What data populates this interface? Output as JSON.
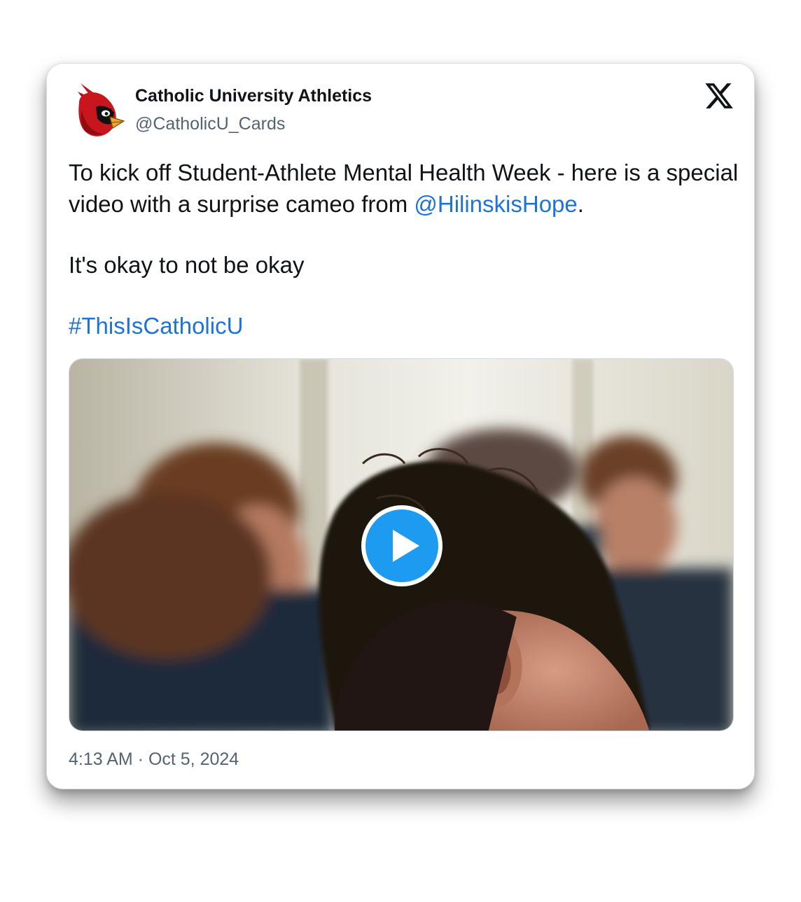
{
  "author": {
    "display_name": "Catholic University Athletics",
    "handle": "@CatholicU_Cards",
    "avatar_icon": "cardinal-mascot-icon"
  },
  "platform": {
    "logo_icon": "x-logo-icon"
  },
  "tweet": {
    "line1": "To kick off Student-Athlete Mental Health Week - here is a special video with a surprise cameo from ",
    "mention": "@HilinskisHope",
    "line1_end": ".",
    "line2": "It's okay to not be okay",
    "hashtag": "#ThisIsCatholicU"
  },
  "media": {
    "type": "video",
    "play_icon": "play-icon",
    "play_color": "#1d9bf0"
  },
  "timestamp": "4:13 AM · Oct 5, 2024",
  "colors": {
    "link": "#1d74d6",
    "text": "#0f1419",
    "secondary": "#536471"
  }
}
